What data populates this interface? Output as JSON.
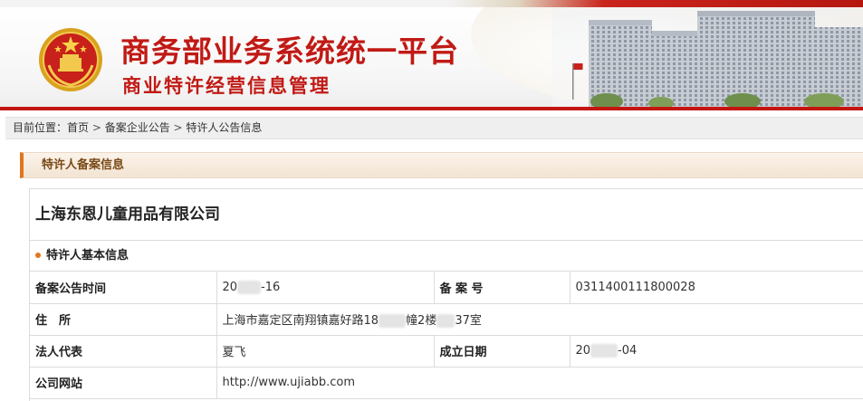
{
  "header": {
    "title": "商务部业务系统统一平台",
    "subtitle": "商业特许经营信息管理"
  },
  "breadcrumb": {
    "prefix": "目前位置：",
    "items": [
      "首页",
      "备案企业公告",
      "特许人公告信息"
    ],
    "separator": " > "
  },
  "section": {
    "title": "特许人备案信息"
  },
  "company": {
    "name": "上海东恩儿童用品有限公司"
  },
  "basic_info": {
    "title": "特许人基本信息",
    "rows": [
      {
        "label1": "备案公告时间",
        "value1_pre": "20",
        "value1_post": "-16",
        "label2": "备 案 号",
        "value2": "0311400111800028"
      },
      {
        "label1": "住　所",
        "value1_a": "上海市嘉定区南翔镇嘉好路18",
        "value1_b": "幢2楼",
        "value1_c": "37室"
      },
      {
        "label1": "法人代表",
        "value1": "夏飞",
        "label2": "成立日期",
        "value2_pre": "20",
        "value2_post": "-04"
      },
      {
        "label1": "公司网站",
        "value1": "http://www.ujiabb.com"
      }
    ]
  },
  "colors": {
    "brand_red": "#c11a15",
    "accent_orange": "#e2751e",
    "section_text": "#7a4a17"
  }
}
